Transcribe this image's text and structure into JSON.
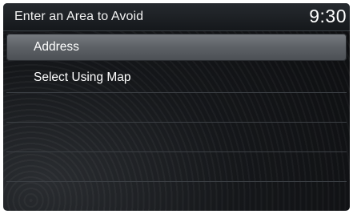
{
  "header": {
    "title": "Enter an Area to Avoid",
    "clock": "9:30"
  },
  "menu": {
    "items": [
      {
        "label": "Address",
        "selected": true
      },
      {
        "label": "Select Using Map",
        "selected": false
      },
      {
        "label": "",
        "selected": false
      },
      {
        "label": "",
        "selected": false
      },
      {
        "label": "",
        "selected": false
      },
      {
        "label": "",
        "selected": false
      }
    ]
  }
}
